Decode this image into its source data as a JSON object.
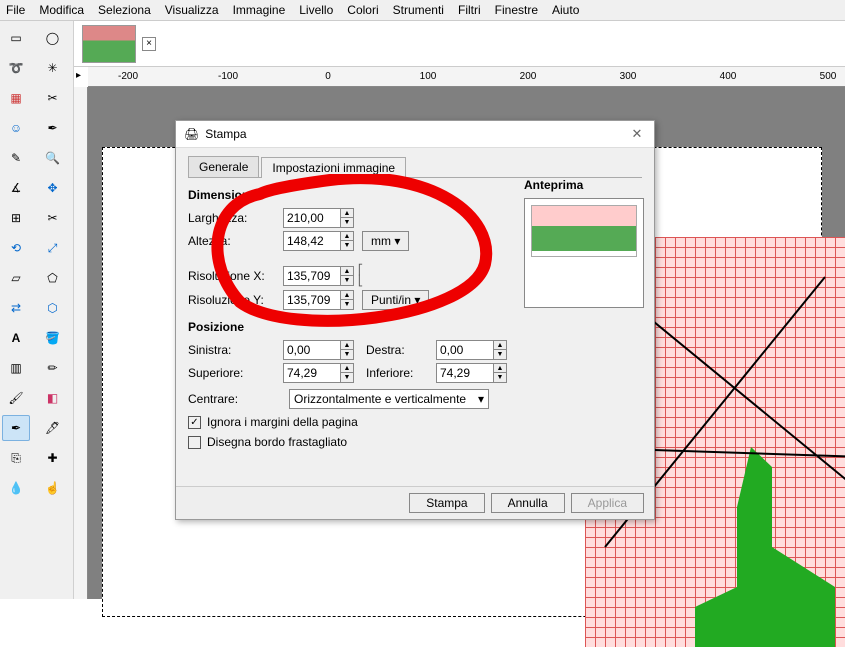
{
  "menu": [
    "File",
    "Modifica",
    "Seleziona",
    "Visualizza",
    "Immagine",
    "Livello",
    "Colori",
    "Strumenti",
    "Filtri",
    "Finestre",
    "Aiuto"
  ],
  "ruler_labels": [
    "-200",
    "-100",
    "0",
    "100",
    "200",
    "300",
    "400",
    "500"
  ],
  "dialog": {
    "title": "Stampa",
    "tabs": {
      "general": "Generale",
      "image": "Impostazioni immagine"
    },
    "dim": {
      "heading": "Dimensione",
      "width_label": "Larghezza:",
      "width": "210,00",
      "height_label": "Altezza:",
      "height": "148,42",
      "unit_mm": "mm",
      "resx_label": "Risoluzione X:",
      "resx": "135,709",
      "resy_label": "Risoluzione Y:",
      "resy": "135,709",
      "unit_dpi": "Punti/in"
    },
    "preview_label": "Anteprima",
    "pos": {
      "heading": "Posizione",
      "left_label": "Sinistra:",
      "left": "0,00",
      "right_label": "Destra:",
      "right": "0,00",
      "top_label": "Superiore:",
      "top": "74,29",
      "bottom_label": "Inferiore:",
      "bottom": "74,29",
      "center_label": "Centrare:",
      "center_value": "Orizzontalmente e verticalmente"
    },
    "chk_ignore": "Ignora i margini della pagina",
    "chk_border": "Disegna bordo frastagliato",
    "buttons": {
      "print": "Stampa",
      "cancel": "Annulla",
      "apply": "Applica"
    }
  }
}
